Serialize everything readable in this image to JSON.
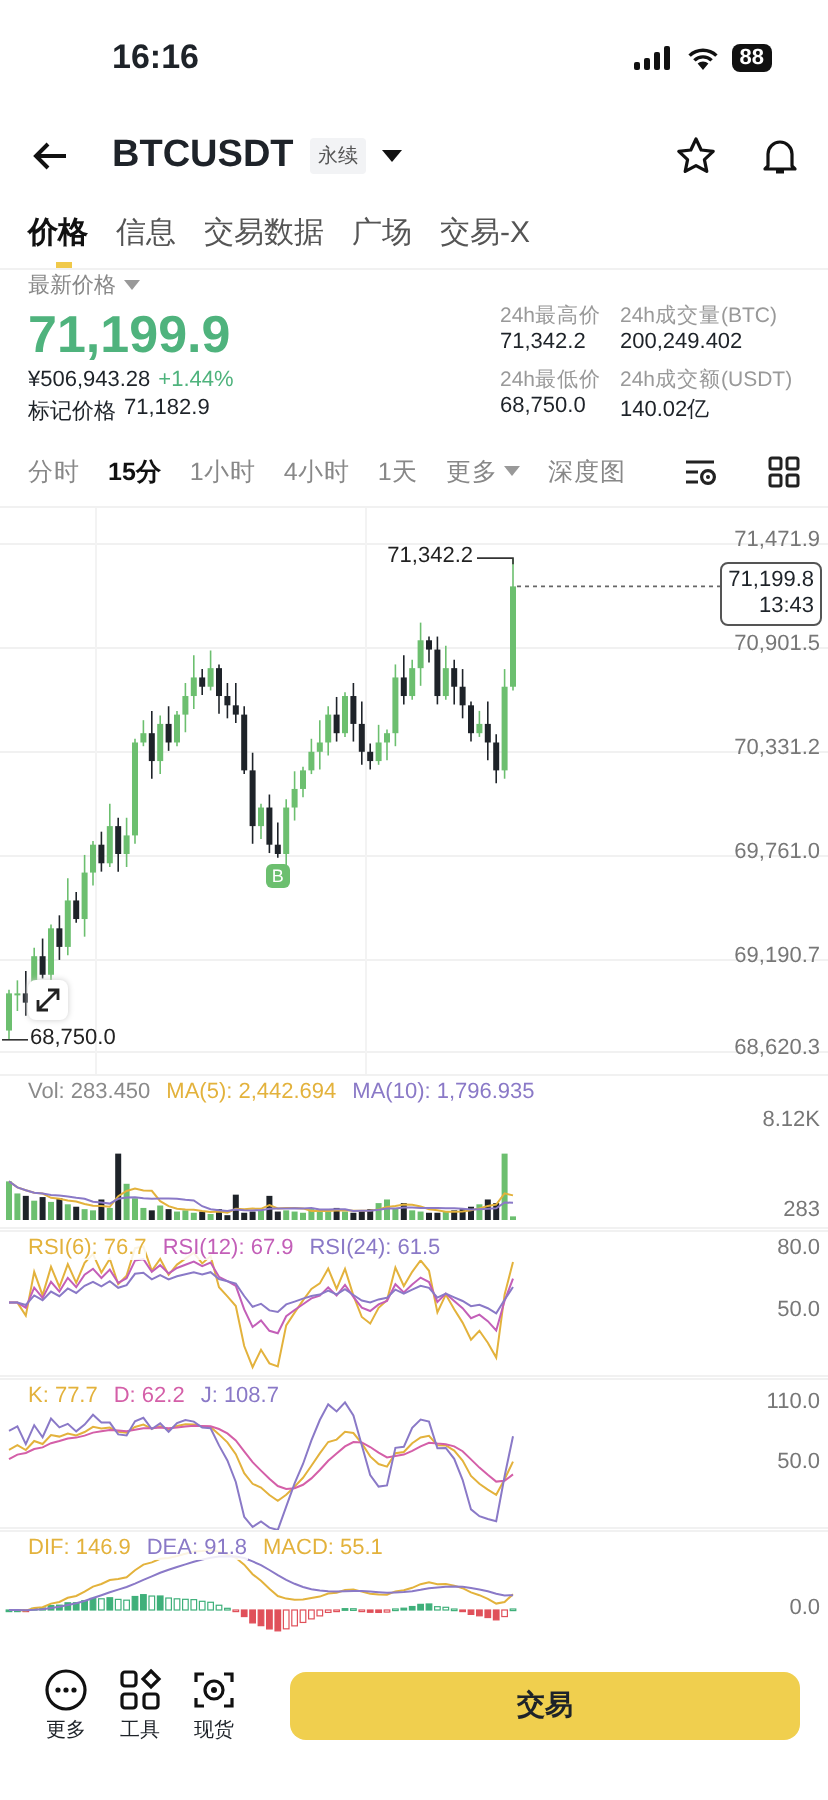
{
  "status_bar": {
    "time": "16:16",
    "battery": "88"
  },
  "header": {
    "symbol": "BTCUSDT",
    "contract_type": "永续"
  },
  "tabs": [
    {
      "label": "价格",
      "selected": true
    },
    {
      "label": "信息",
      "selected": false
    },
    {
      "label": "交易数据",
      "selected": false
    },
    {
      "label": "广场",
      "selected": false
    },
    {
      "label": "交易-X",
      "selected": false
    }
  ],
  "price": {
    "label": "最新价格",
    "last": "71,199.9",
    "cny": "¥506,943.28",
    "change": "+1.44%",
    "mark_label": "标记价格",
    "mark_price": "71,182.9"
  },
  "stats": [
    {
      "label": "24h最高价",
      "value": "71,342.2"
    },
    {
      "label": "24h成交量(BTC)",
      "value": "200,249.402"
    },
    {
      "label": "24h最低价",
      "value": "68,750.0"
    },
    {
      "label": "24h成交额(USDT)",
      "value": "140.02亿"
    }
  ],
  "intervals": [
    {
      "label": "分时",
      "selected": false,
      "kind": "plain"
    },
    {
      "label": "15分",
      "selected": true,
      "kind": "plain"
    },
    {
      "label": "1小时",
      "selected": false,
      "kind": "plain"
    },
    {
      "label": "4小时",
      "selected": false,
      "kind": "plain"
    },
    {
      "label": "1天",
      "selected": false,
      "kind": "plain"
    },
    {
      "label": "更多",
      "selected": false,
      "kind": "dropdown"
    },
    {
      "label": "深度图",
      "selected": false,
      "kind": "plain"
    }
  ],
  "price_chart": {
    "y_labels": [
      "71,471.9",
      "70,901.5",
      "70,331.2",
      "69,761.0",
      "69,190.7",
      "68,620.3"
    ],
    "high_label": "71,342.2",
    "low_label": "68,750.0",
    "last_price": "71,199.8",
    "countdown": "13:43",
    "marker": "B"
  },
  "volume": {
    "legend": [
      {
        "text": "Vol: 283.450",
        "color": "#8a8a8a"
      },
      {
        "text": "MA(5): 2,442.694",
        "color": "#e3b23c"
      },
      {
        "text": "MA(10): 1,796.935",
        "color": "#8a79c7"
      }
    ],
    "y_labels": [
      "8.12K",
      "283"
    ]
  },
  "rsi": {
    "legend": [
      {
        "text": "RSI(6): 76.7",
        "color": "#e3b23c"
      },
      {
        "text": "RSI(12): 67.9",
        "color": "#c35fb8"
      },
      {
        "text": "RSI(24): 61.5",
        "color": "#8a79c7"
      }
    ],
    "y_labels": [
      "80.0",
      "50.0"
    ]
  },
  "kdj": {
    "legend": [
      {
        "text": "K: 77.7",
        "color": "#e3b23c"
      },
      {
        "text": "D: 62.2",
        "color": "#d45fa8"
      },
      {
        "text": "J: 108.7",
        "color": "#8a79c7"
      }
    ],
    "y_labels": [
      "110.0",
      "50.0"
    ]
  },
  "macd": {
    "legend": [
      {
        "text": "DIF: 146.9",
        "color": "#e3b23c"
      },
      {
        "text": "DEA: 91.8",
        "color": "#8a79c7"
      },
      {
        "text": "MACD: 55.1",
        "color": "#e3b23c"
      }
    ],
    "y_labels": [
      "0.0"
    ]
  },
  "bottom_bar": {
    "actions": [
      {
        "label": "更多",
        "kind": "more"
      },
      {
        "label": "工具",
        "kind": "tools"
      },
      {
        "label": "现货",
        "kind": "spot"
      }
    ],
    "trade_button": "交易"
  }
}
